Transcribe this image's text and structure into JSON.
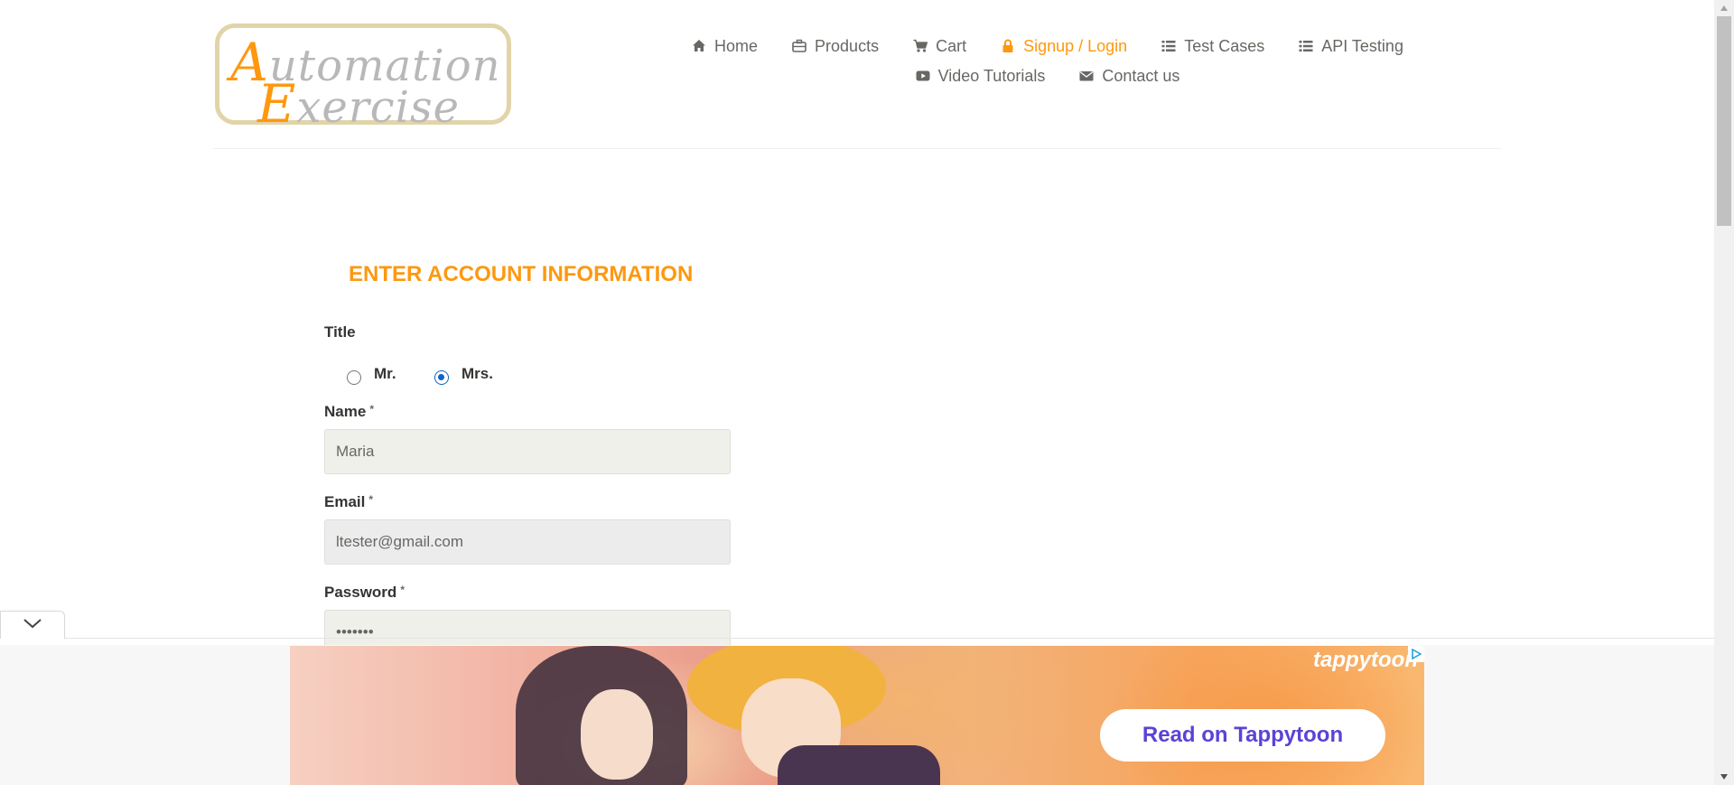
{
  "logo": {
    "line1_cap": "A",
    "line1_rest": "utomation",
    "line2_cap": "E",
    "line2_rest": "xercise"
  },
  "nav": {
    "row1": [
      {
        "label": "Home",
        "icon": "home-icon"
      },
      {
        "label": "Products",
        "icon": "briefcase-icon"
      },
      {
        "label": "Cart",
        "icon": "cart-icon"
      },
      {
        "label": "Signup / Login",
        "icon": "lock-icon",
        "active": true
      },
      {
        "label": "Test Cases",
        "icon": "list-icon"
      },
      {
        "label": "API Testing",
        "icon": "list-icon"
      }
    ],
    "row2": [
      {
        "label": "Video Tutorials",
        "icon": "youtube-icon"
      },
      {
        "label": "Contact us",
        "icon": "envelope-icon"
      }
    ]
  },
  "form": {
    "title": "ENTER ACCOUNT INFORMATION",
    "title_label": "Title",
    "options": [
      {
        "label": "Mr.",
        "checked": false
      },
      {
        "label": "Mrs.",
        "checked": true
      }
    ],
    "name_label": "Name",
    "name_value": "Maria",
    "email_label": "Email",
    "email_value": "ltester@gmail.com",
    "password_label": "Password",
    "password_value": "•••••••",
    "required_mark": "*"
  },
  "ad": {
    "brand": "tappytoon",
    "cta": "Read on Tappytoon"
  },
  "colors": {
    "accent": "#fe980f",
    "text": "#696763",
    "radio": "#0f62c7",
    "ad_cta": "#5a43d6"
  }
}
